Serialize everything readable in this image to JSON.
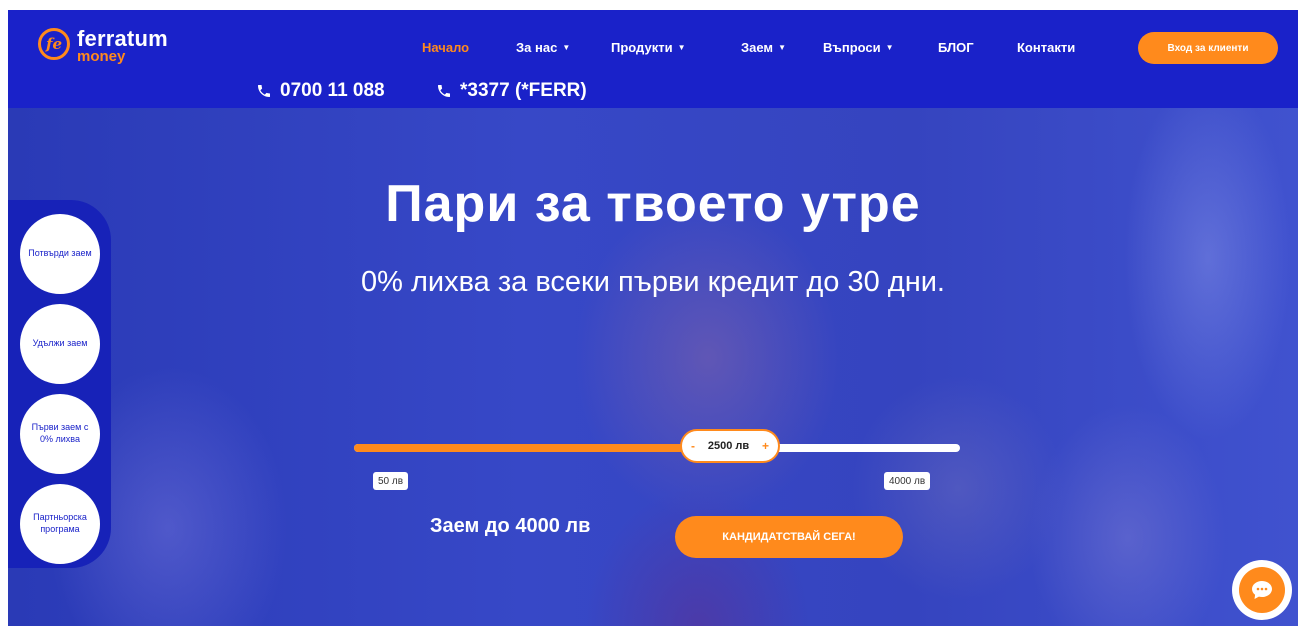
{
  "header": {
    "logo": {
      "name": "ferratum",
      "sub": "money",
      "mark": "fe"
    },
    "nav": [
      {
        "label": "Начало",
        "active": true,
        "dropdown": false
      },
      {
        "label": "За нас",
        "active": false,
        "dropdown": true
      },
      {
        "label": "Продукти",
        "active": false,
        "dropdown": true
      },
      {
        "label": "Заем",
        "active": false,
        "dropdown": true
      },
      {
        "label": "Въпроси",
        "active": false,
        "dropdown": true
      },
      {
        "label": "БЛОГ",
        "active": false,
        "dropdown": false
      },
      {
        "label": "Контакти",
        "active": false,
        "dropdown": false
      }
    ],
    "login_label": "Вход за клиенти",
    "phones": [
      "0700 11 088",
      "*3377 (*FERR)"
    ]
  },
  "hero": {
    "title": "Пари за твоето утре",
    "subtitle": "0% лихва за всеки първи кредит до 30 дни."
  },
  "side_panel": [
    {
      "label": "Потвърди заем"
    },
    {
      "label": "Удължи заем"
    },
    {
      "label": "Първи заем с 0% лихва"
    },
    {
      "label": "Партньорска програма"
    }
  ],
  "slider": {
    "min_label": "50 лв",
    "max_label": "4000 лв",
    "value_label": "2500 лв",
    "min": 50,
    "max": 4000,
    "value": 2500,
    "minus": "-",
    "plus": "+"
  },
  "loan_label": "Заем до 4000 лв",
  "apply_label": "КАНДИДАТСТВАЙ СЕГА!",
  "colors": {
    "header_bg": "#1a22c9",
    "accent": "#ff8a1c",
    "hero_bg": "#2f3fc4",
    "text": "#ffffff"
  }
}
